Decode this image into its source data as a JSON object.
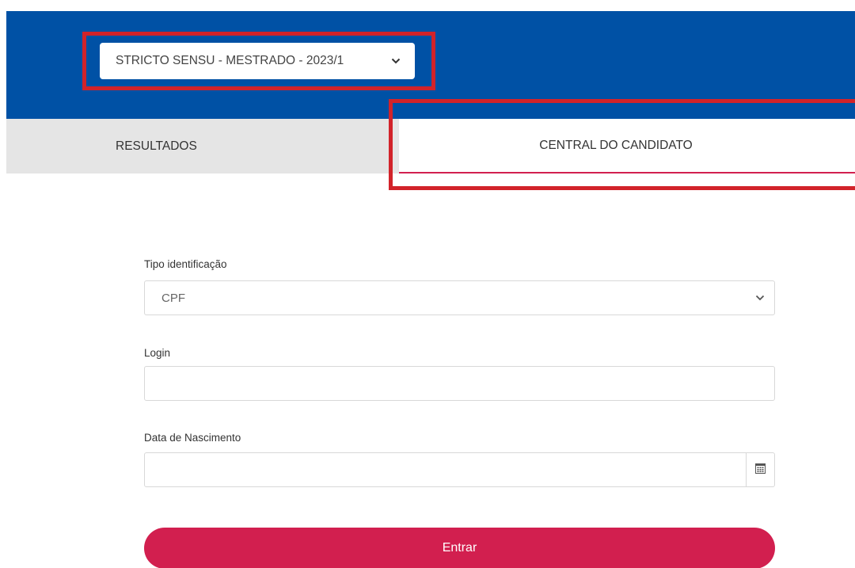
{
  "header": {
    "process_select": {
      "value": "STRICTO SENSU - MESTRADO - 2023/1"
    }
  },
  "tabs": [
    {
      "label": "RESULTADOS",
      "active": false
    },
    {
      "label": "CENTRAL DO CANDIDATO",
      "active": true
    }
  ],
  "form": {
    "id_type": {
      "label": "Tipo identificação",
      "value": "CPF"
    },
    "login": {
      "label": "Login",
      "value": ""
    },
    "birth_date": {
      "label": "Data de Nascimento",
      "value": ""
    },
    "submit_label": "Entrar"
  },
  "icons": {
    "select_arrow": "chevron-down-icon",
    "date_picker": "calendar-icon"
  },
  "colors": {
    "header_blue": "#0051a5",
    "accent": "#d21f4f",
    "highlight_red": "#d2232a",
    "tab_inactive_bg": "#e5e5e5"
  }
}
